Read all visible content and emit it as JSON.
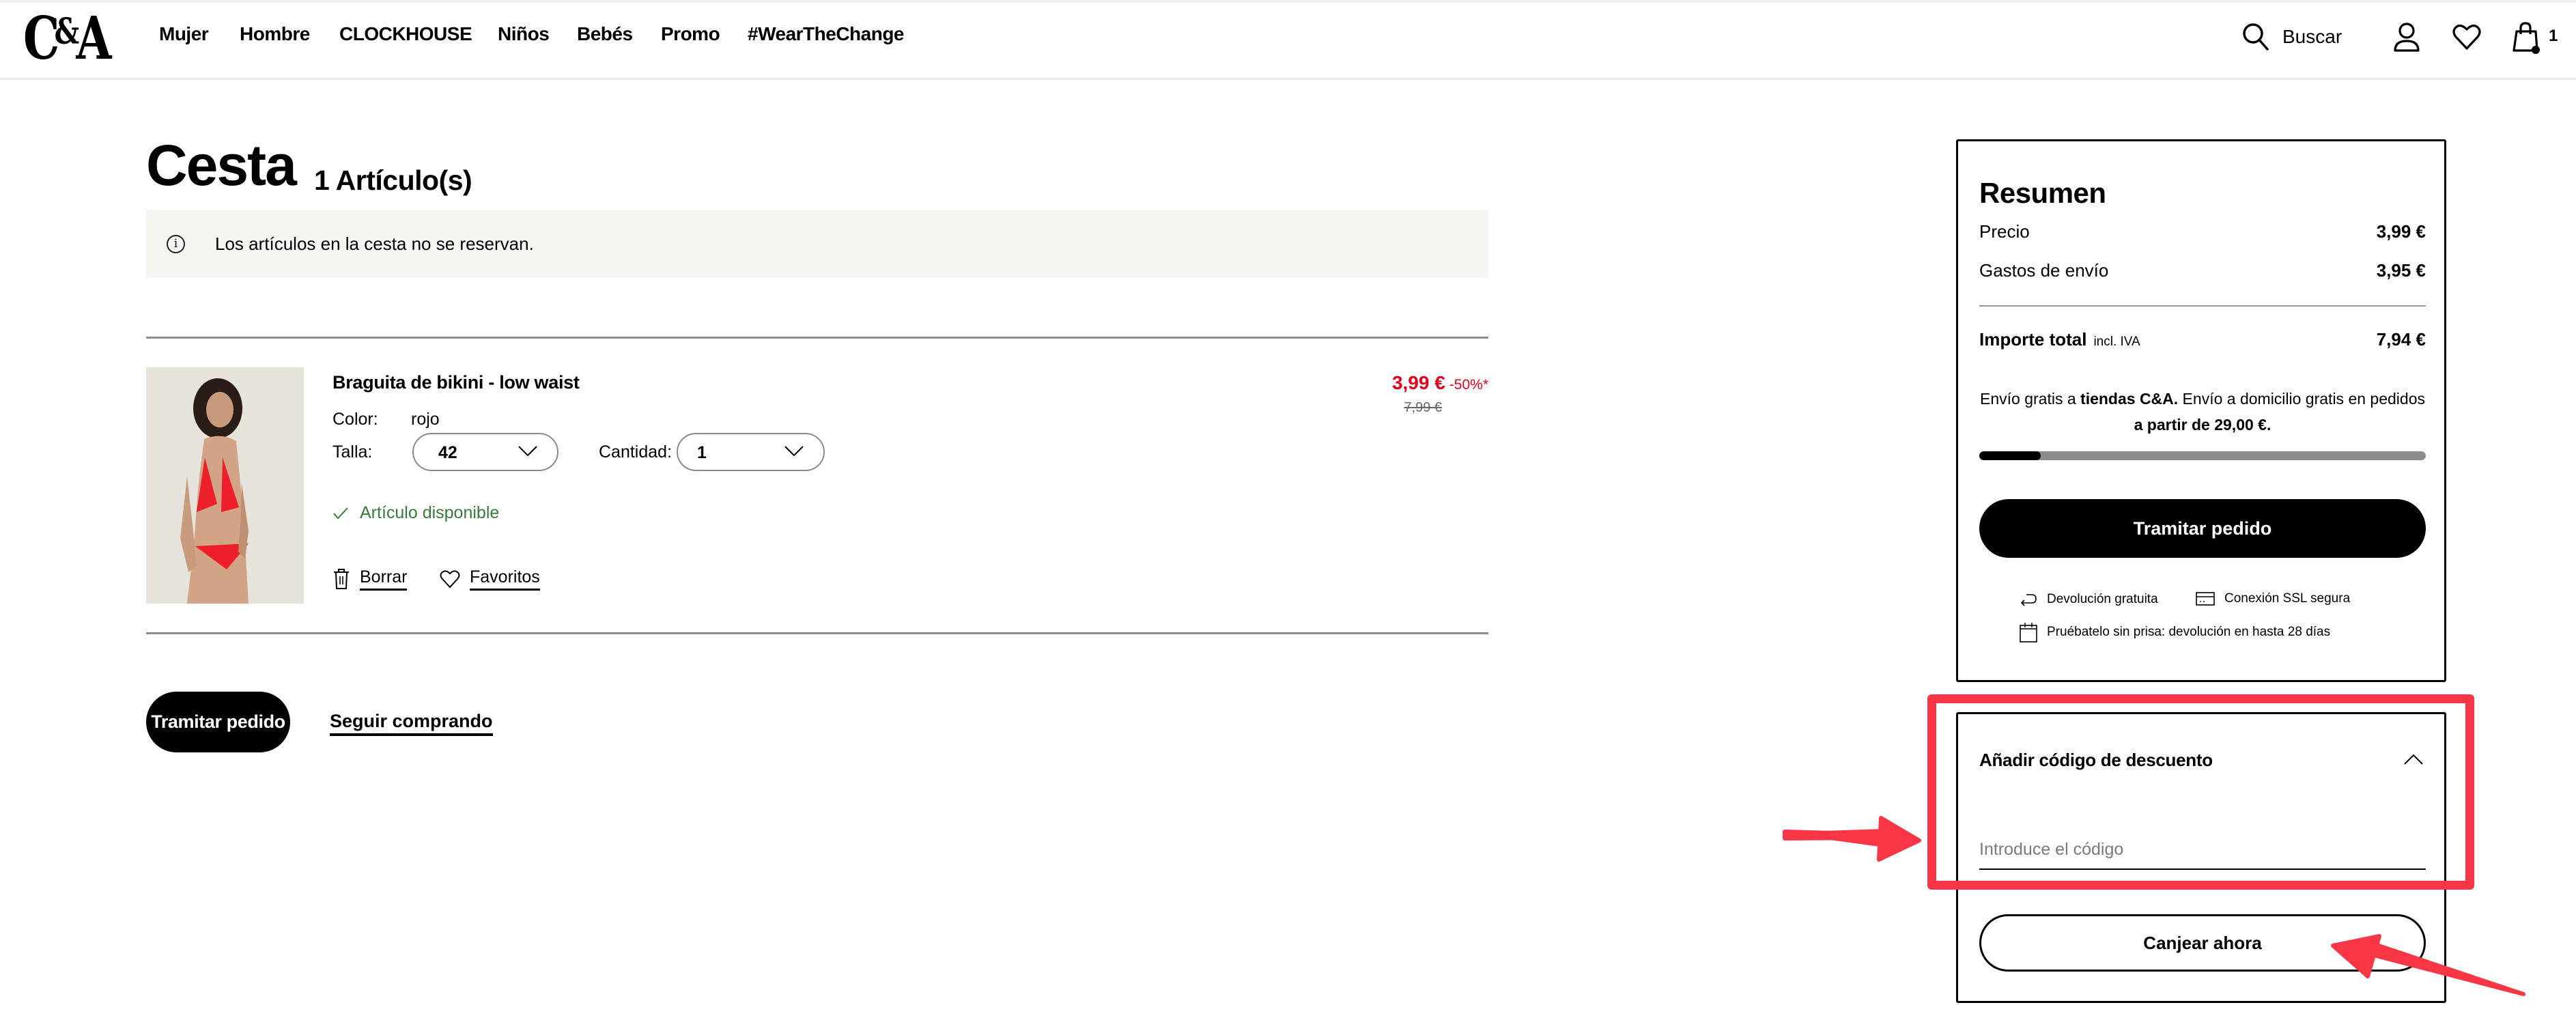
{
  "header": {
    "logo": "C&A",
    "logo_parts": [
      "C",
      "&",
      "A"
    ],
    "nav": [
      "Mujer",
      "Hombre",
      "CLOCKHOUSE",
      "Niños",
      "Bebés",
      "Promo",
      "#WearTheChange"
    ],
    "search_label": "Buscar",
    "icons": [
      "search-icon",
      "user-icon",
      "heart-icon",
      "shopping-bag-icon"
    ],
    "cart_count": "1"
  },
  "cart": {
    "title": "Cesta",
    "item_count": "1 Artículo(s)",
    "notice": "Los artículos en la cesta no se reservan.",
    "notice_icon": "info-icon",
    "item": {
      "name": "Braguita de bikini - low waist",
      "color_label": "Color:",
      "color_value": "rojo",
      "size_label": "Talla:",
      "size_value": "42",
      "qty_label": "Cantidad:",
      "qty_value": "1",
      "availability": "Artículo disponible",
      "price": "3,99 €",
      "discount": "-50%*",
      "old_price": "7,99 €",
      "delete_label": "Borrar",
      "favorite_label": "Favoritos",
      "image_alt": "Modelo con bikini rojo"
    },
    "checkout_label": "Tramitar pedido",
    "continue_label": "Seguir comprando"
  },
  "summary": {
    "title": "Resumen",
    "rows": [
      {
        "label": "Precio",
        "value": "3,99 €"
      },
      {
        "label": "Gastos de envío",
        "value": "3,95 €"
      }
    ],
    "total_label": "Importe total",
    "total_sub": "incl. IVA",
    "total_value": "7,94 €",
    "shipping_text": {
      "t1": "Envío gratis a ",
      "b1": "tiendas C&A.",
      "t2": " Envío a domicilio gratis en pedidos ",
      "b2": "a partir de 29,00 €."
    },
    "free_shipping_progress": 0.1376,
    "checkout_label": "Tramitar pedido",
    "benefits": [
      {
        "icon": "return-arrow-icon",
        "label": "Devolución gratuita"
      },
      {
        "icon": "credit-card-icon",
        "label": "Conexión SSL segura"
      },
      {
        "icon": "calendar-icon",
        "label": "Pruébatelo sin prisa: devolución en hasta 28 días"
      }
    ]
  },
  "discount": {
    "title": "Añadir código de descuento",
    "expanded": true,
    "input_value": "",
    "input_placeholder": "Introduce el código",
    "redeem_label": "Canjear ahora"
  },
  "annotations": {
    "color": "#f93646",
    "highlight": "discount-code-field",
    "arrows_pointing_to": [
      "discount-code-input",
      "redeem-button"
    ]
  },
  "colors": {
    "sale_red": "#e3001b",
    "available_green": "#3a7a3a",
    "banner_bg": "#f6f5f1"
  }
}
